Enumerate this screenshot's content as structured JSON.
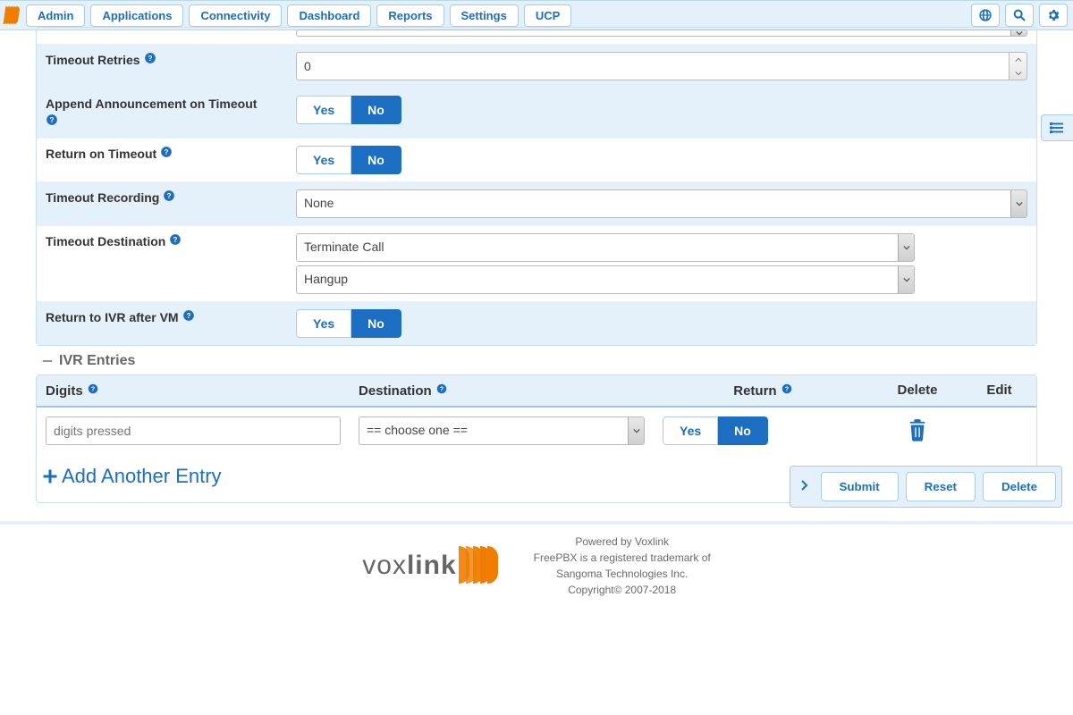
{
  "nav": {
    "items": [
      "Admin",
      "Applications",
      "Connectivity",
      "Dashboard",
      "Reports",
      "Settings",
      "UCP"
    ]
  },
  "yes_label": "Yes",
  "no_label": "No",
  "fields": {
    "timeout_retries": {
      "label": "Timeout Retries",
      "value": "0"
    },
    "append_ann": {
      "label": "Append Announcement on Timeout",
      "value": "No"
    },
    "return_timeout": {
      "label": "Return on Timeout",
      "value": "No"
    },
    "timeout_recording": {
      "label": "Timeout Recording",
      "value": "None"
    },
    "timeout_dest": {
      "label": "Timeout Destination",
      "value1": "Terminate Call",
      "value2": "Hangup"
    },
    "return_ivr_vm": {
      "label": "Return to IVR after VM",
      "value": "No"
    }
  },
  "entries_section": {
    "title": "IVR Entries",
    "headers": {
      "digits": "Digits",
      "destination": "Destination",
      "return": "Return",
      "delete": "Delete",
      "edit": "Edit"
    },
    "row": {
      "digits_placeholder": "digits pressed",
      "dest_placeholder": "== choose one ==",
      "return": "No"
    },
    "add_label": "Add Another Entry"
  },
  "actions": {
    "submit": "Submit",
    "reset": "Reset",
    "delete": "Delete"
  },
  "footer": {
    "brand": "voxlink",
    "line1": "Powered by Voxlink",
    "line2": "FreePBX is a registered trademark of",
    "line3": "Sangoma Technologies Inc.",
    "line4": "Copyright© 2007-2018"
  }
}
